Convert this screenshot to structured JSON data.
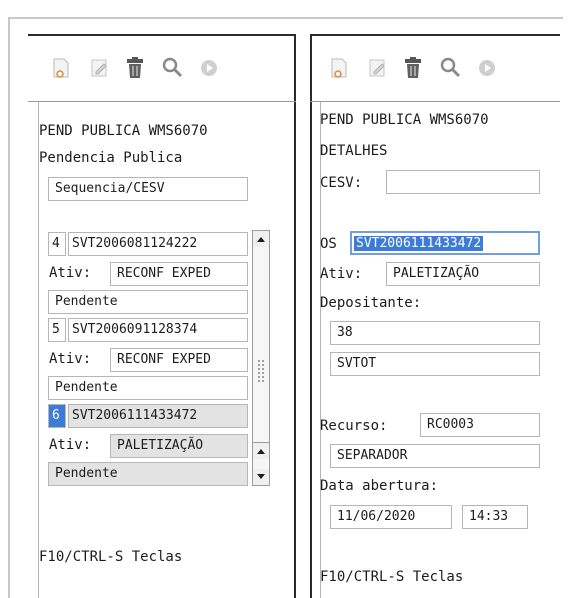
{
  "colors": {
    "accent": "#3d7bd8",
    "panel_border": "#2a2a2a",
    "field_border": "#b6b6b6",
    "selected_row": "#e3e3e3"
  },
  "toolbar_icons": [
    "new-file-icon",
    "edit-icon",
    "trash-icon",
    "search-icon",
    "play-circle-icon"
  ],
  "left_panel": {
    "title": "PEND PUBLICA WMS6070",
    "subtitle": "Pendencia Publica",
    "filter_value": "Sequencia/CESV",
    "rows": [
      {
        "num": "4",
        "code": "SVT2006081124222",
        "ativ_label": "Ativ:",
        "ativ": "RECONF EXPED",
        "status": "Pendente"
      },
      {
        "num": "5",
        "code": "SVT2006091128374",
        "ativ_label": "Ativ:",
        "ativ": "RECONF EXPED",
        "status": "Pendente"
      },
      {
        "num": "6",
        "code": "SVT2006111433472",
        "ativ_label": "Ativ:",
        "ativ": "PALETIZAÇÃO",
        "status": "Pendente"
      }
    ],
    "footer": "F10/CTRL-S Teclas"
  },
  "right_panel": {
    "title": "PEND PUBLICA WMS6070",
    "subtitle": "DETALHES",
    "cesv_label": "CESV:",
    "cesv_value": "",
    "os_label": "OS",
    "os_value": "SVT2006111433472",
    "ativ_label": "Ativ:",
    "ativ_value": "PALETIZAÇÃO",
    "depositante_label": "Depositante:",
    "depositante_code": "38",
    "depositante_name": "SVTOT",
    "recurso_label": "Recurso:",
    "recurso_value": "RC0003",
    "recurso_role": "SEPARADOR",
    "data_label": "Data abertura:",
    "data_date": "11/06/2020",
    "data_time": "14:33",
    "footer": "F10/CTRL-S Teclas"
  }
}
